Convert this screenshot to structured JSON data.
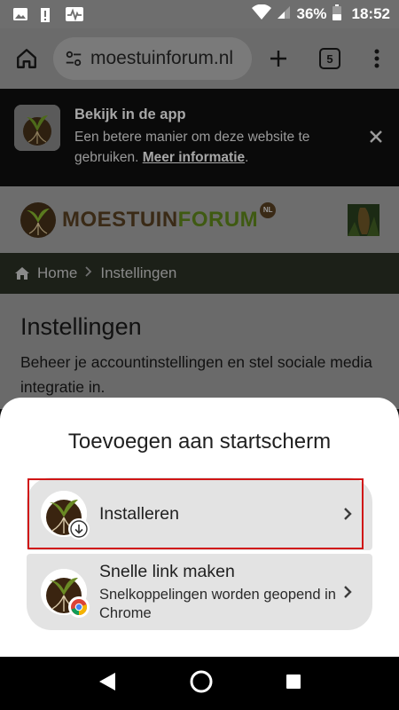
{
  "status_bar": {
    "battery": "36%",
    "time": "18:52",
    "icons": [
      "image-icon",
      "alert-icon",
      "activity-icon",
      "wifi-icon",
      "signal-icon",
      "battery-icon"
    ]
  },
  "browser": {
    "url": "moestuinforum.nl",
    "tab_count": "5",
    "icons": [
      "home-icon",
      "site-settings-icon",
      "new-tab-icon",
      "menu-icon"
    ]
  },
  "app_banner": {
    "title": "Bekijk in de app",
    "description": "Een betere manier om deze website te gebruiken.",
    "link": "Meer informatie",
    "link_suffix": "."
  },
  "site": {
    "logo_word1": "MOESTUIN",
    "logo_word2": "FORUM",
    "logo_badge": "NL"
  },
  "breadcrumb": {
    "home": "Home",
    "current": "Instellingen"
  },
  "page": {
    "title": "Instellingen",
    "description": "Beheer je accountinstellingen en stel sociale media integratie in."
  },
  "sheet": {
    "title": "Toevoegen aan startscherm",
    "options": [
      {
        "title": "Installeren",
        "badge_icon": "download-icon"
      },
      {
        "title": "Snelle link maken",
        "subtitle": "Snelkoppelingen worden geopend in Chrome",
        "badge_icon": "chrome-icon"
      }
    ]
  },
  "colors": {
    "highlight": "#d01616",
    "brand_brown": "#3a2a16",
    "brand_green": "#3f5a12"
  }
}
